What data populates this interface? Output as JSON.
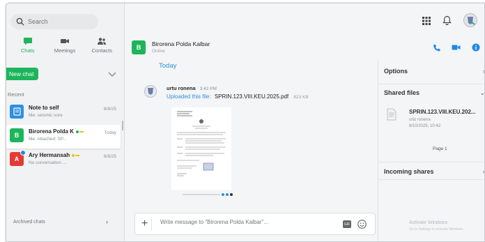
{
  "search": {
    "placeholder": "Search"
  },
  "nav": {
    "tabs": [
      {
        "label": "Chats",
        "active": true
      },
      {
        "label": "Meetings",
        "active": false
      },
      {
        "label": "Contacts",
        "active": false
      }
    ]
  },
  "sidebar": {
    "new_chat_label": "New chat",
    "recent_label": "Recent",
    "archived_label": "Archived chats",
    "chats": [
      {
        "initial": "",
        "name": "Note to self",
        "subtitle": "Me: seismic sore",
        "date": "8/8/25",
        "color": "#2f8fe0"
      },
      {
        "initial": "B",
        "name": "Birorena Polda K",
        "subtitle": "Me: Attached: SP...",
        "date": "Today",
        "color": "#1db55b"
      },
      {
        "initial": "A",
        "name": "Ary Hermansah",
        "subtitle": "No conversation ...",
        "date": "8/8/25",
        "color": "#e53935"
      }
    ]
  },
  "conversation": {
    "avatar_initial": "B",
    "name": "Birorena Polda Kalbar",
    "status": "Online",
    "day_label": "Today",
    "message": {
      "sender": "urtu ronena",
      "time": "3:42 PM",
      "action": "Uploaded this file:",
      "filename": "SPRIN.123.VIII.KEU.2025.pdf",
      "size": "823 KB"
    },
    "composer_placeholder": "Write message to \"Birorena Polda Kalbar\"..."
  },
  "right_panel": {
    "options_label": "Options",
    "shared_files_label": "Shared files",
    "incoming_shares_label": "Incoming shares",
    "file": {
      "name": "SPRIN.123.VIII.KEU.202...",
      "by": "urtu ronena",
      "date": "8/10/2025, 10:42"
    },
    "page_label": "Page 1",
    "activate_title": "Activate Windows",
    "activate_sub": "Go to Settings to activate Windows."
  },
  "colors": {
    "accent_green": "#1db55b",
    "accent_blue": "#2f8fe0"
  }
}
